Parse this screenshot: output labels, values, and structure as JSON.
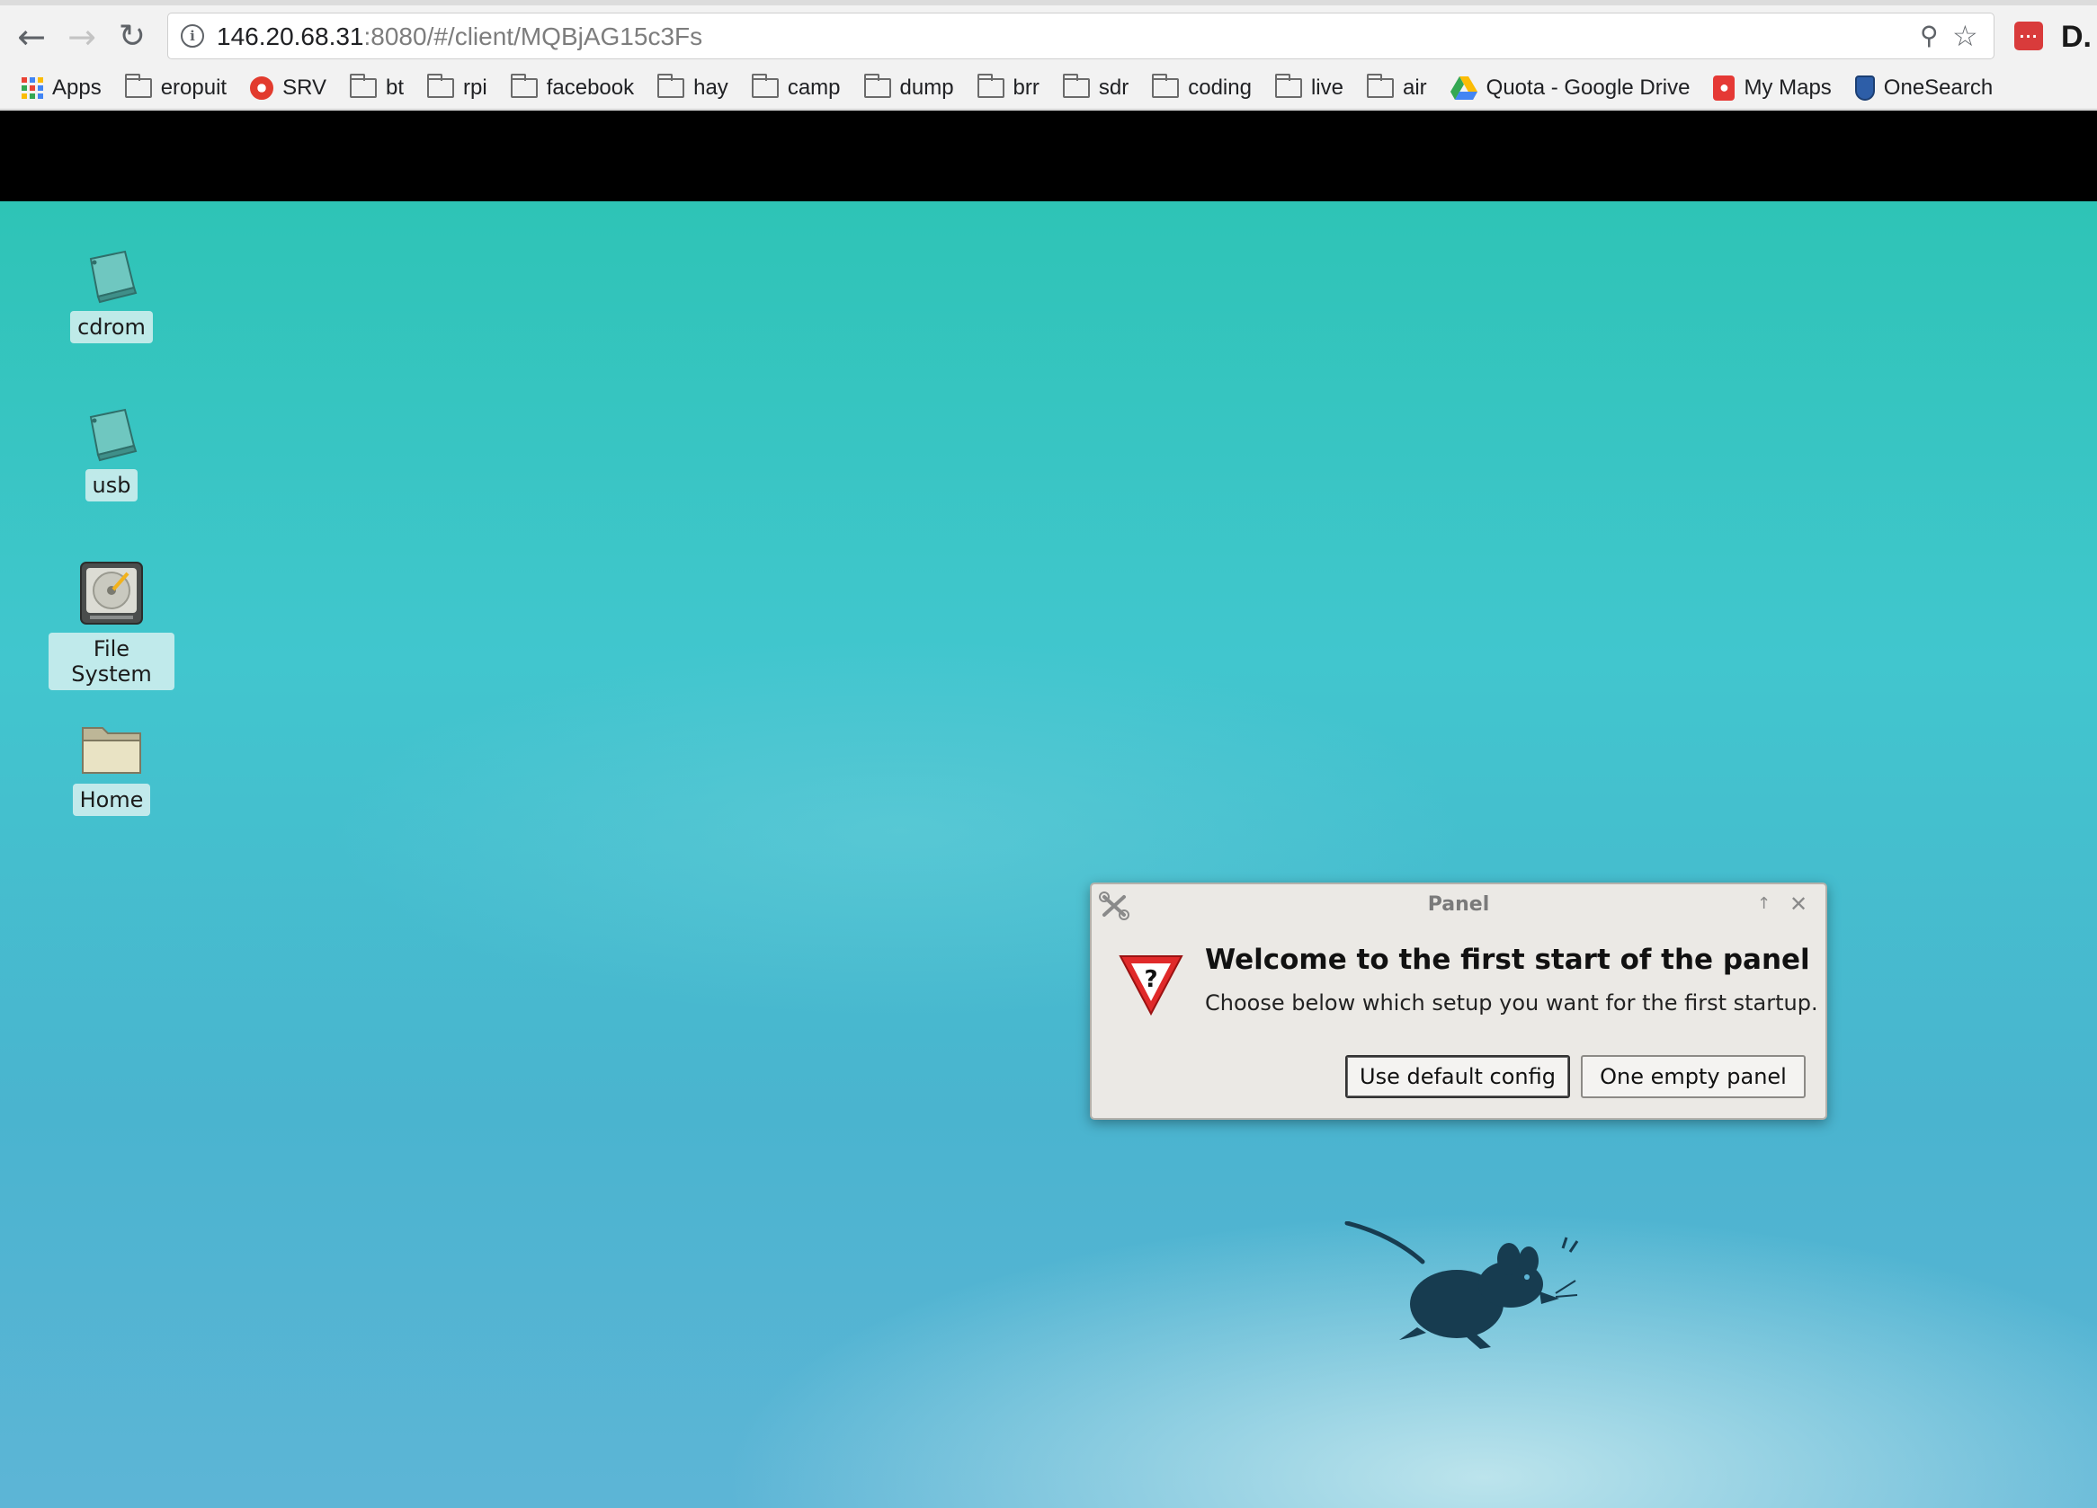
{
  "browser": {
    "url_host": "146.20.68.31",
    "url_rest": ":8080/#/client/MQBjAG15c3Fs",
    "nav": {
      "back_icon": "arrow-left-icon",
      "forward_icon": "arrow-right-icon",
      "reload_icon": "reload-icon"
    },
    "extensions": {
      "ext2_label": "D."
    }
  },
  "bookmarks": [
    {
      "label": "Apps",
      "icon": "apps-grid-icon"
    },
    {
      "label": "eropuit",
      "icon": "folder-icon"
    },
    {
      "label": "SRV",
      "icon": "favicon-icon"
    },
    {
      "label": "bt",
      "icon": "folder-icon"
    },
    {
      "label": "rpi",
      "icon": "folder-icon"
    },
    {
      "label": "facebook",
      "icon": "folder-icon"
    },
    {
      "label": "hay",
      "icon": "folder-icon"
    },
    {
      "label": "camp",
      "icon": "folder-icon"
    },
    {
      "label": "dump",
      "icon": "folder-icon"
    },
    {
      "label": "brr",
      "icon": "folder-icon"
    },
    {
      "label": "sdr",
      "icon": "folder-icon"
    },
    {
      "label": "coding",
      "icon": "folder-icon"
    },
    {
      "label": "live",
      "icon": "folder-icon"
    },
    {
      "label": "air",
      "icon": "folder-icon"
    },
    {
      "label": "Quota - Google Drive",
      "icon": "google-drive-icon"
    },
    {
      "label": "My Maps",
      "icon": "map-pin-icon"
    },
    {
      "label": "OneSearch",
      "icon": "shield-icon"
    }
  ],
  "desktop": {
    "icons": [
      {
        "label": "cdrom",
        "icon": "drive-icon"
      },
      {
        "label": "usb",
        "icon": "drive-icon"
      },
      {
        "label": "File System",
        "icon": "hard-disk-icon"
      },
      {
        "label": "Home",
        "icon": "folder-icon"
      }
    ]
  },
  "dialog": {
    "title": "Panel",
    "heading": "Welcome to the first start of the panel",
    "message": "Choose below which setup you want for the first startup.",
    "buttons": {
      "default_config": "Use default config",
      "empty_panel": "One empty panel"
    }
  },
  "colors": {
    "desktop_top": "#2ec4b6",
    "desktop_bottom": "#5db5d6",
    "mouse_logo": "#173c50",
    "warning_red": "#e02a2a"
  }
}
